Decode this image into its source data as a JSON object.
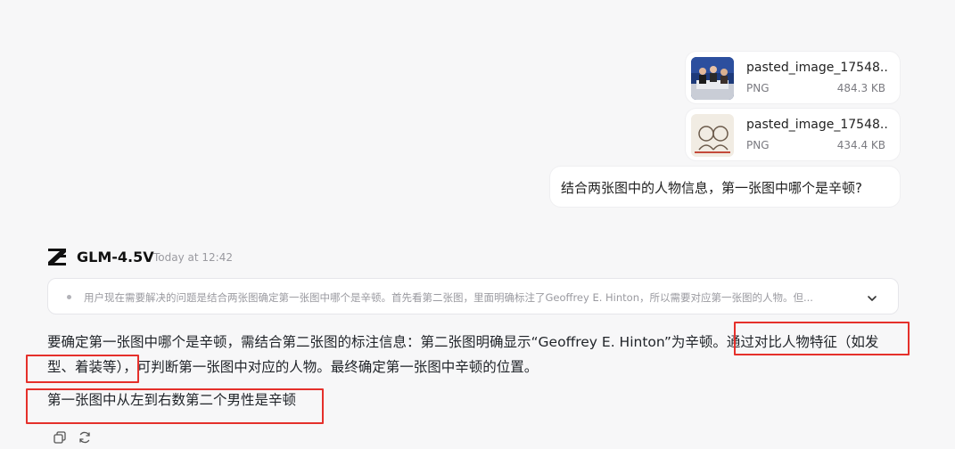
{
  "attachments": [
    {
      "name": "pasted_image_17548...",
      "type": "PNG",
      "size": "484.3 KB",
      "thumb_icon": "photo-thumbnail-icon"
    },
    {
      "name": "pasted_image_17548...",
      "type": "PNG",
      "size": "434.4 KB",
      "thumb_icon": "portrait-sketch-thumbnail-icon"
    }
  ],
  "user_message": "结合两张图中的人物信息，第一张图中哪个是辛顿?",
  "model": {
    "name": "GLM-4.5V",
    "timestamp": "Today at 12:42",
    "logo_icon": "glm-logo-icon"
  },
  "thinking": {
    "text": "用户现在需要解决的问题是结合两张图确定第一张图中哪个是辛顿。首先看第二张图，里面明确标注了Geoffrey E. Hinton，所以需要对应第一张图的人物。但...",
    "toggle_icon": "chevron-down-icon"
  },
  "answer": {
    "paragraph": "要确定第一张图中哪个是辛顿，需结合第二张图的标注信息：第二张图明确显示“Geoffrey E. Hinton”为辛顿。通过对比人物特征（如发型、着装等），可判断第一张图中对应的人物。最终确定第一张图中辛顿的位置。",
    "conclusion": "第一张图中从左到右数第二个男性是辛顿"
  },
  "actions": [
    {
      "icon": "copy-icon"
    },
    {
      "icon": "regenerate-icon"
    }
  ],
  "colors": {
    "background": "#f7f7f8",
    "card": "#ffffff",
    "highlight_box": "#e5302b"
  }
}
